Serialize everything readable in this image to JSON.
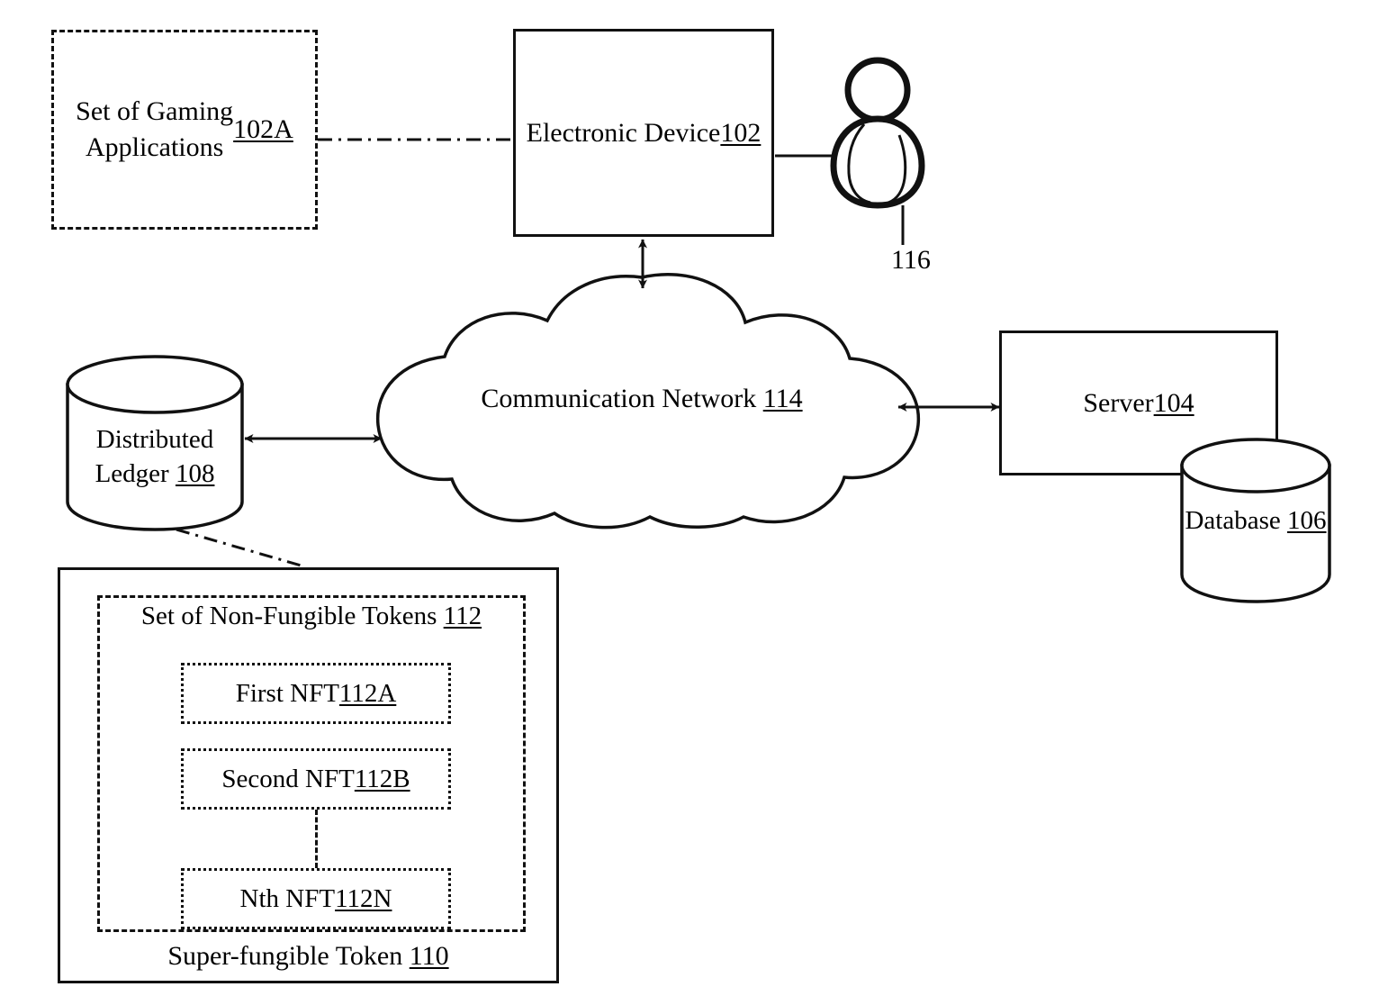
{
  "figure": {
    "type": "patent-block-diagram",
    "background_color": "#ffffff",
    "line_color": "#111111"
  },
  "nodes": {
    "gaming_applications": {
      "label": "Set of Gaming\nApplications ",
      "ref": "102A",
      "shape": "dash-dot-rectangle"
    },
    "electronic_device": {
      "label": "Electronic Device\n",
      "ref": "102",
      "shape": "rectangle"
    },
    "user": {
      "ref": "116",
      "icon": "user-person-icon"
    },
    "communication_network": {
      "label": "Communication Network ",
      "ref": "114",
      "shape": "cloud"
    },
    "distributed_ledger": {
      "label": "Distributed\nLedger ",
      "ref": "108",
      "shape": "cylinder"
    },
    "server": {
      "label": "Server ",
      "ref": "104",
      "shape": "rectangle"
    },
    "database": {
      "label": "Database\n",
      "ref": "106",
      "shape": "cylinder"
    },
    "super_fungible_token": {
      "label": "Super-fungible Token ",
      "ref": "110",
      "shape": "rectangle"
    },
    "nft_set": {
      "label": "Set of Non-Fungible Tokens ",
      "ref": "112",
      "shape": "dash-dot-rectangle"
    },
    "nft_first": {
      "label": "First NFT ",
      "ref": "112A",
      "shape": "dotted-rectangle"
    },
    "nft_second": {
      "label": "Second NFT ",
      "ref": "112B",
      "shape": "dotted-rectangle"
    },
    "nft_nth": {
      "label": "Nth NFT ",
      "ref": "112N",
      "shape": "dotted-rectangle"
    }
  },
  "connections": [
    {
      "from": "gaming_applications",
      "to": "electronic_device",
      "style": "dash-dot",
      "arrows": "none"
    },
    {
      "from": "electronic_device",
      "to": "user",
      "style": "solid",
      "arrows": "none"
    },
    {
      "from": "electronic_device",
      "to": "communication_network",
      "style": "solid",
      "arrows": "both"
    },
    {
      "from": "distributed_ledger",
      "to": "communication_network",
      "style": "solid",
      "arrows": "both"
    },
    {
      "from": "communication_network",
      "to": "server",
      "style": "solid",
      "arrows": "both"
    },
    {
      "from": "distributed_ledger",
      "to": "super_fungible_token",
      "style": "dash-dot",
      "arrows": "none"
    },
    {
      "from": "nft_second",
      "to": "nft_nth",
      "style": "dashed",
      "arrows": "none"
    },
    {
      "from": "user",
      "to": "user_ref_116",
      "style": "leader",
      "arrows": "none"
    }
  ]
}
